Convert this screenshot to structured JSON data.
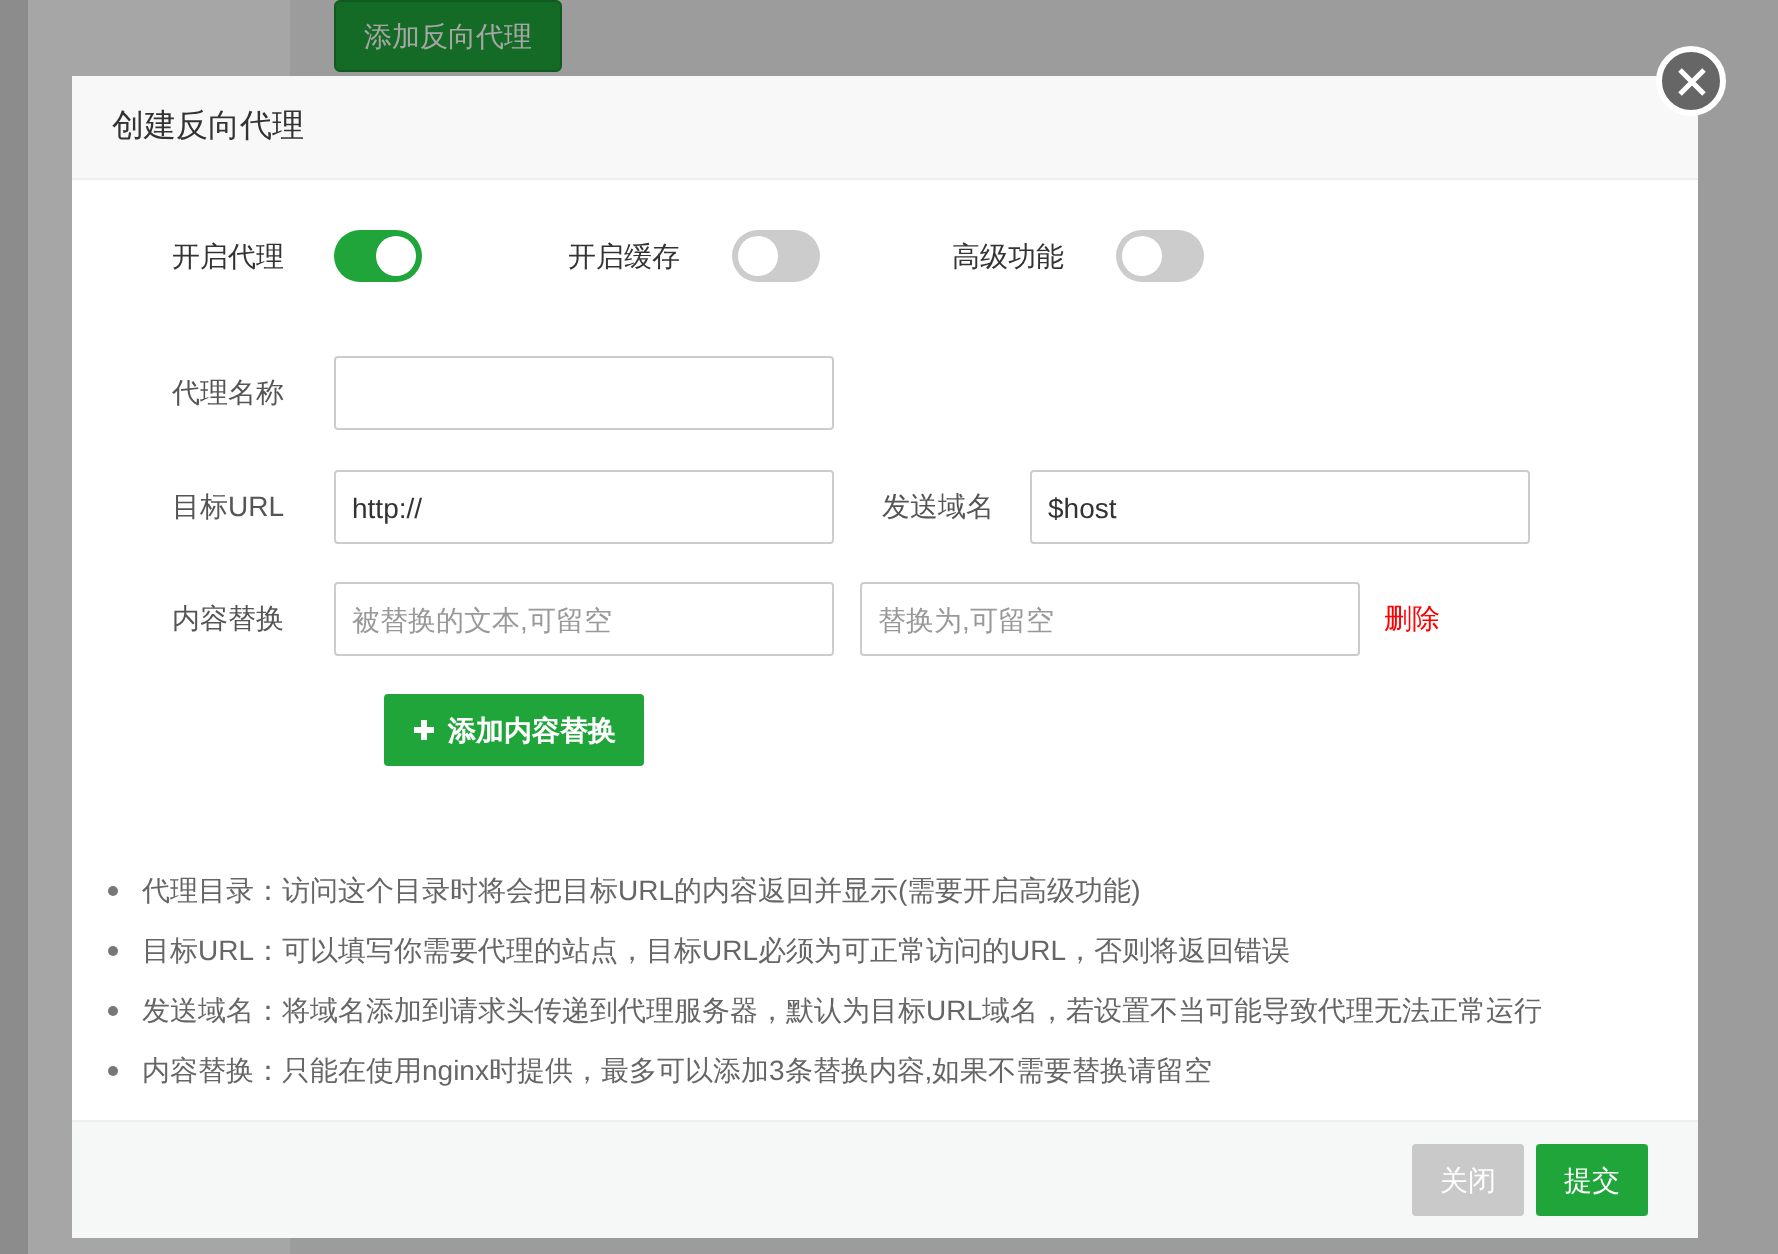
{
  "background": {
    "add_button": "添加反向代理"
  },
  "dialog": {
    "title": "创建反向代理",
    "toggles": [
      {
        "label": "开启代理",
        "on": true
      },
      {
        "label": "开启缓存",
        "on": false
      },
      {
        "label": "高级功能",
        "on": false
      }
    ],
    "name_field": {
      "label": "代理名称"
    },
    "target_url": {
      "label": "目标URL",
      "value": "http://"
    },
    "send_domain": {
      "label": "发送域名",
      "value": "$host"
    },
    "replace": {
      "label": "内容替换",
      "from_placeholder": "被替换的文本,可留空",
      "to_placeholder": "替换为,可留空",
      "delete_link": "删除"
    },
    "add_replace_button": "添加内容替换",
    "notes": [
      "代理目录：访问这个目录时将会把目标URL的内容返回并显示(需要开启高级功能)",
      "目标URL：可以填写你需要代理的站点，目标URL必须为可正常访问的URL，否则将返回错误",
      "发送域名：将域名添加到请求头传递到代理服务器，默认为目标URL域名，若设置不当可能导致代理无法正常运行",
      "内容替换：只能在使用nginx时提供，最多可以添加3条替换内容,如果不需要替换请留空"
    ],
    "buttons": [
      {
        "label": "关闭",
        "kind": "secondary"
      },
      {
        "label": "提交",
        "kind": "primary"
      }
    ]
  }
}
